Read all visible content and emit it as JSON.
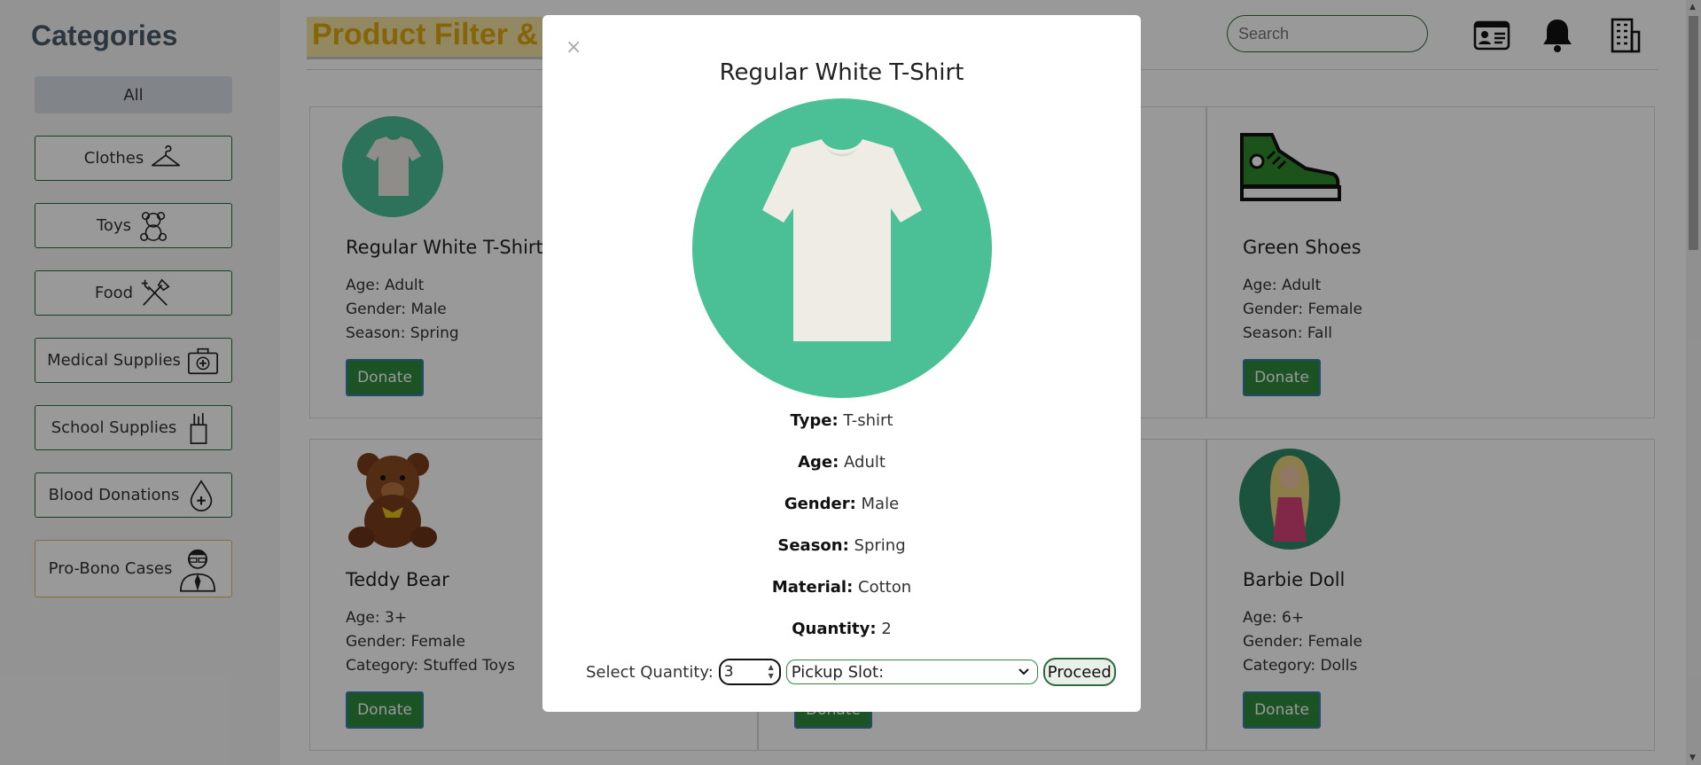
{
  "sidebar": {
    "title": "Categories",
    "items": [
      {
        "label": "All",
        "icon": ""
      },
      {
        "label": "Clothes",
        "icon": "hanger-icon"
      },
      {
        "label": "Toys",
        "icon": "teddy-icon"
      },
      {
        "label": "Food",
        "icon": "fork-knife-icon"
      },
      {
        "label": "Medical Supplies",
        "icon": "medical-kit-icon"
      },
      {
        "label": "School Supplies",
        "icon": "pencil-cup-icon"
      },
      {
        "label": "Blood Donations",
        "icon": "blood-drop-icon"
      },
      {
        "label": "Pro-Bono Cases",
        "icon": "lawyer-icon"
      }
    ]
  },
  "header": {
    "title": "Product Filter & S",
    "search_placeholder": "Search",
    "icons": [
      "id-card-icon",
      "bell-icon",
      "building-icon"
    ]
  },
  "products": [
    {
      "name": "Regular White T-Shirt",
      "lines": [
        "Age: Adult",
        "Gender: Male",
        "Season: Spring"
      ],
      "button": "Donate"
    },
    {
      "name": "Green Shoes",
      "lines": [
        "Age: Adult",
        "Gender: Female",
        "Season: Fall"
      ],
      "button": "Donate"
    },
    {
      "name": "Teddy Bear",
      "lines": [
        "Age: 3+",
        "Gender: Female",
        "Category: Stuffed Toys"
      ],
      "button": "Donate"
    },
    {
      "name": "Barbie Doll",
      "lines": [
        "Age: 6+",
        "Gender: Female",
        "Category: Dolls"
      ],
      "button": "Donate"
    },
    {
      "button": "Donate"
    }
  ],
  "modal": {
    "close": "×",
    "title": "Regular White T-Shirt",
    "details": [
      {
        "label": "Type:",
        "value": "T-shirt"
      },
      {
        "label": "Age:",
        "value": "Adult"
      },
      {
        "label": "Gender:",
        "value": "Male"
      },
      {
        "label": "Season:",
        "value": "Spring"
      },
      {
        "label": "Material:",
        "value": "Cotton"
      },
      {
        "label": "Quantity:",
        "value": "2"
      }
    ],
    "select_quantity_label": "Select Quantity:",
    "quantity_value": "3",
    "pickup_slot": "Pickup Slot:",
    "proceed": "Proceed"
  },
  "colors": {
    "accent": "#2f8a3e",
    "modal_circle": "#4bbf96",
    "title_text": "#e0a90f"
  }
}
